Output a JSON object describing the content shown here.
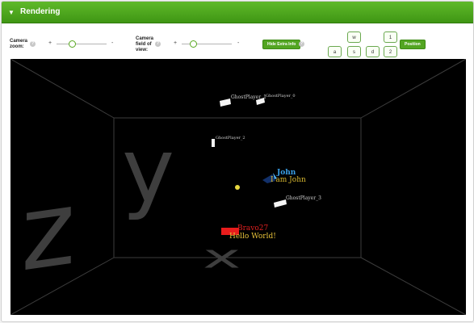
{
  "panel": {
    "title": "Rendering",
    "toggle_icon": "triangle-down"
  },
  "controls": {
    "zoom_label": "Camera zoom:",
    "fov_label": "Camera field of view:",
    "help_symbol": "?",
    "plus": "+",
    "minus": "-",
    "zoom_level": 0.3,
    "fov_level": 0.23,
    "hide_extra_button": "Hide Extra Info",
    "position_button": "Position",
    "keys": {
      "w": "w",
      "a": "a",
      "s": "s",
      "d": "d",
      "one": "1",
      "two": "2"
    }
  },
  "scene": {
    "axis_z": "z",
    "axis_y": "y",
    "axis_x": "x",
    "players": [
      {
        "name": "GhostPlayer_1"
      },
      {
        "name": "GhostPlayer_0"
      },
      {
        "name": "GhostPlayer_2"
      },
      {
        "name": "GhostPlayer_3"
      },
      {
        "name": "John",
        "message": "I am John"
      },
      {
        "name": "Bravo27",
        "message": "Hello World!"
      }
    ]
  },
  "colors": {
    "accent": "#4aa41c",
    "background": "#000000",
    "wall_lines": "#3c3c3c",
    "axis_letters": "#3e3e3e",
    "ghost_label": "#d0d0d0",
    "john_name": "#3aa0e8",
    "john_message": "#d8b830",
    "bravo_name": "#e02020",
    "bravo_message": "#e8c23a",
    "bravo_box": "#e81c1c"
  }
}
